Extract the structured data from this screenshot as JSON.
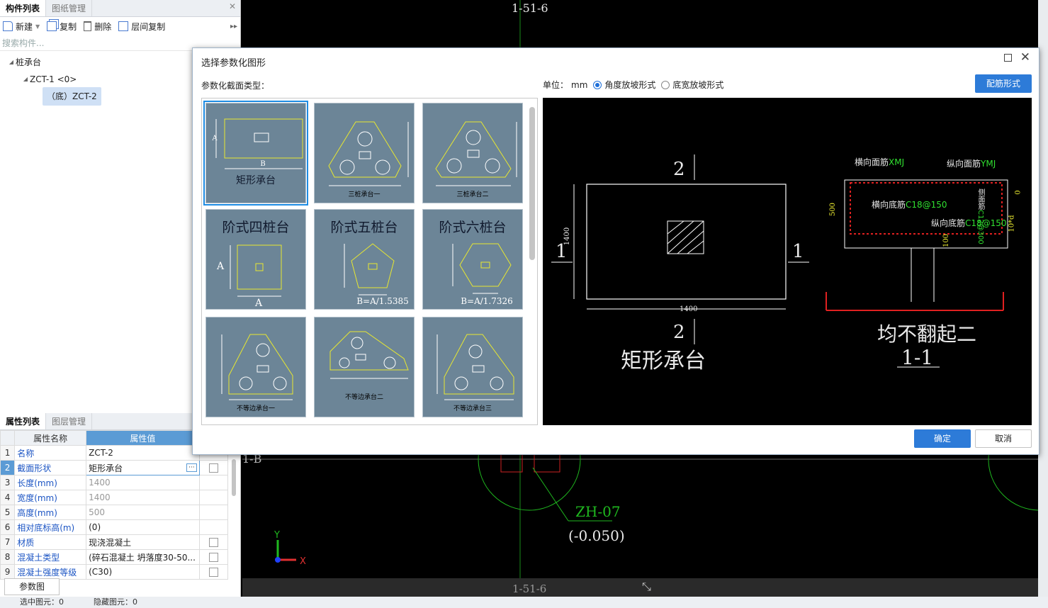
{
  "left_panel": {
    "tabs": [
      "构件列表",
      "图纸管理"
    ],
    "toolbar": {
      "new_label": "新建",
      "copy_label": "复制",
      "delete_label": "删除",
      "layer_copy_label": "层间复制"
    },
    "search_placeholder": "搜索构件...",
    "tree": {
      "root": "桩承台",
      "child": "ZCT-1 <0>",
      "leaf": "（底）ZCT-2"
    }
  },
  "props": {
    "tabs": [
      "属性列表",
      "图层管理"
    ],
    "col_name": "属性名称",
    "col_value": "属性值",
    "rows": [
      {
        "n": "1",
        "name": "名称",
        "value": "ZCT-2"
      },
      {
        "n": "2",
        "name": "截面形状",
        "value": "矩形承台"
      },
      {
        "n": "3",
        "name": "长度(mm)",
        "value": "1400"
      },
      {
        "n": "4",
        "name": "宽度(mm)",
        "value": "1400"
      },
      {
        "n": "5",
        "name": "高度(mm)",
        "value": "500"
      },
      {
        "n": "6",
        "name": "相对底标高(m)",
        "value": "(0)"
      },
      {
        "n": "7",
        "name": "材质",
        "value": "现浇混凝土"
      },
      {
        "n": "8",
        "name": "混凝土类型",
        "value": "(碎石混凝土 坍落度30-50..."
      },
      {
        "n": "9",
        "name": "混凝土强度等级",
        "value": "(C30)"
      }
    ],
    "param_button": "参数图"
  },
  "status": {
    "selected": "选中图元：0",
    "hidden": "隐藏图元：0"
  },
  "canvas": {
    "axis_top": "1-51-6",
    "axis_bottom": "1-51-6",
    "axis_left": "1-B",
    "pile_label": "ZH-07",
    "pile_elev": "(-0.050)",
    "axis_y": "Y",
    "axis_x": "X"
  },
  "dialog": {
    "title": "选择参数化图形",
    "section_type_label": "参数化截面类型：",
    "unit_label": "单位：",
    "unit_value": "mm",
    "radio_angle": "角度放坡形式",
    "radio_width": "底宽放坡形式",
    "rebar_button": "配筋形式",
    "ok": "确定",
    "cancel": "取消",
    "tiles": {
      "t1": "矩形承台",
      "t2": "三桩承台一",
      "t3": "三桩承台二",
      "t4": "阶式四桩台",
      "t5": "阶式五桩台",
      "t5b": "B=A/1.5385",
      "t6": "阶式六桩台",
      "t6b": "B=A/1.7326",
      "t7": "不等边承台一",
      "t8": "不等边承台二",
      "t9": "不等边承台三",
      "letter_a": "A",
      "letter_b": "B"
    },
    "preview": {
      "plan_title": "矩形承台",
      "dim_w": "1400",
      "dim_h": "1400",
      "mark_2": "2",
      "mark_1": "1",
      "section_title": "1-1",
      "note": "均不翻起二",
      "h_top": "横向面筋",
      "h_top_code": "XMJ",
      "v_top": "纵向面筋",
      "v_top_code": "YMJ",
      "h_bot": "横向底筋",
      "h_bot_code": "C18@150",
      "v_bot": "纵向底筋",
      "v_bot_code": "C18@150",
      "side": "侧面筋",
      "side_code": "C12@300",
      "d500": "500",
      "d100": "100",
      "d10d": "10*d",
      "d0": "0"
    }
  }
}
